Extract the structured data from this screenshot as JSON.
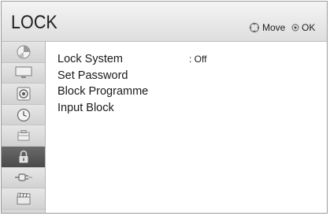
{
  "header": {
    "title": "LOCK",
    "move_label": "Move",
    "ok_label": "OK"
  },
  "sidebar": {
    "items": [
      {
        "icon": "picture-icon",
        "active": false
      },
      {
        "icon": "screen-icon",
        "active": false
      },
      {
        "icon": "audio-icon",
        "active": false
      },
      {
        "icon": "time-icon",
        "active": false
      },
      {
        "icon": "option-icon",
        "active": false
      },
      {
        "icon": "lock-icon",
        "active": true
      },
      {
        "icon": "network-icon",
        "active": false
      },
      {
        "icon": "media-icon",
        "active": false
      }
    ]
  },
  "menu": {
    "items": [
      {
        "label": "Lock System",
        "value": ": Off"
      },
      {
        "label": "Set Password"
      },
      {
        "label": "Block Programme"
      },
      {
        "label": "Input Block"
      }
    ]
  },
  "colors": {
    "header_bg": "#e8e8e8",
    "sidebar_bg": "#d8d8d8",
    "sidebar_active_bg": "#5a5a5a",
    "text": "#1a1a1a"
  }
}
